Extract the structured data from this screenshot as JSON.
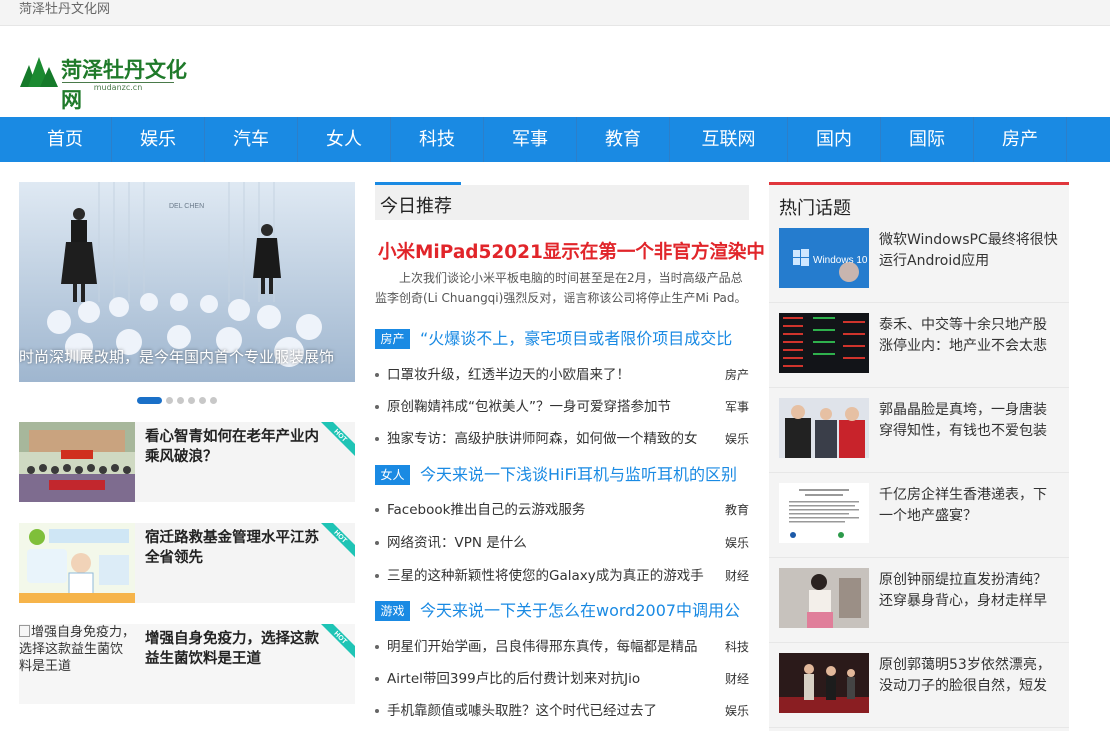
{
  "topbar": {
    "site_name": "菏泽牡丹文化网"
  },
  "logo": {
    "title": "菏泽牡丹文化网",
    "subtitle": "mudanzc.cn"
  },
  "nav": [
    "首页",
    "娱乐",
    "汽车",
    "女人",
    "科技",
    "军事",
    "教育",
    "互联网",
    "国内",
    "国际",
    "房产"
  ],
  "slider": {
    "caption": "时尚深圳展改期，是今年国内首个专业服装展饰",
    "brand_text": "DEL CHEN",
    "active_index": 0,
    "total": 6
  },
  "hot_items": [
    {
      "title": "看心智青如何在老年产业内乘风破浪？",
      "badge": "HOT"
    },
    {
      "title": "宿迁路救基金管理水平江苏全省领先",
      "badge": "HOT"
    },
    {
      "title": "增强自身免疫力，选择这款益生菌饮料是王道",
      "badge": "HOT",
      "alt": "增强自身免疫力，选择这款益生菌饮料是王道"
    }
  ],
  "today": {
    "header": "今日推荐",
    "headline": "小米MiPad52021显示在第一个非官方渲染中",
    "summary": "上次我们谈论小米平板电脑的时间甚至是在2月，当时高级产品总监李创奇(Li Chuangqi)强烈反对，谣言称该公司将停止生产Mi Pad。",
    "groups": [
      {
        "tag": "房产",
        "title": "“火爆谈不上，豪宅项目或者限价项目成交比",
        "items": [
          {
            "text": "口罩妆升级，红透半边天的小欧眉来了！",
            "cat": "房产"
          },
          {
            "text": "原创鞠婧祎成“包袱美人”？一身可爱穿搭参加节",
            "cat": "军事"
          },
          {
            "text": "独家专访：高级护肤讲师阿森，如何做一个精致的女",
            "cat": "娱乐"
          }
        ]
      },
      {
        "tag": "女人",
        "title": "今天来说一下浅谈HiFi耳机与监听耳机的区别",
        "items": [
          {
            "text": "Facebook推出自己的云游戏服务",
            "cat": "教育"
          },
          {
            "text": "网络资讯：VPN 是什么",
            "cat": "娱乐"
          },
          {
            "text": "三星的这种新颖性将使您的Galaxy成为真正的游戏手",
            "cat": "财经"
          }
        ]
      },
      {
        "tag": "游戏",
        "title": "今天来说一下关于怎么在word2007中调用公",
        "items": [
          {
            "text": "明星们开始学画，吕良伟得邢东真传，每幅都是精品",
            "cat": "科技"
          },
          {
            "text": "Airtel带回399卢比的后付费计划来对抗Jio",
            "cat": "财经"
          },
          {
            "text": "手机靠颜值或噱头取胜？这个时代已经过去了",
            "cat": "娱乐"
          }
        ]
      }
    ]
  },
  "hot_topics": {
    "header": "热门话题",
    "items": [
      {
        "title": "微软WindowsPC最终将很快运行Android应用",
        "thumb_text": "Windows 10"
      },
      {
        "title": "泰禾、中交等十余只地产股涨停业内：地产业不会太悲"
      },
      {
        "title": "郭晶晶脸是真垮，一身唐装穿得知性，有钱也不爱包装"
      },
      {
        "title": "千亿房企祥生香港递表，下一个地产盛宴？"
      },
      {
        "title": "原创钟丽缇拉直发扮清纯？还穿暴身背心，身材走样早"
      },
      {
        "title": "原创郭蔼明53岁依然漂亮，没动刀子的脸很自然，短发"
      }
    ]
  },
  "colors": {
    "nav_blue": "#1a8ae3",
    "headline_red": "#e1252a",
    "hot_red": "#e0363c",
    "ribbon_teal": "#1fc4b5"
  }
}
